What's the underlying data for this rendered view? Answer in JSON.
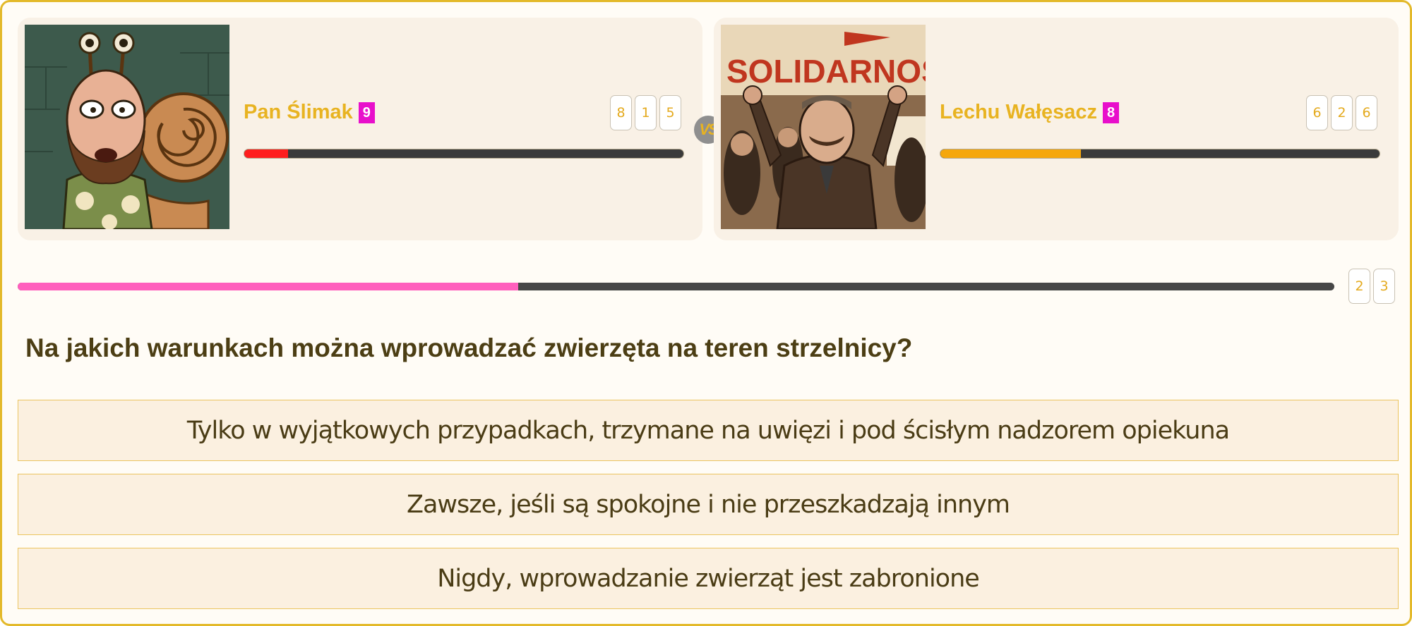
{
  "player1": {
    "name": "Pan Ślimak",
    "level": "9",
    "score_digits": [
      "8",
      "1",
      "5"
    ],
    "hp_fraction": 0.1,
    "hp_color": "#ff1e1e",
    "avatar_icon": "snail-man-portrait"
  },
  "player2": {
    "name": "Lechu Wałęsacz",
    "level": "8",
    "score_digits": [
      "6",
      "2",
      "6"
    ],
    "hp_fraction": 0.32,
    "hp_color": "#f5a70d",
    "avatar_icon": "solidarnosc-rally-portrait",
    "avatar_text": "SOLIDARNOŚĆ"
  },
  "vs_label": "VS",
  "quiz": {
    "progress_fraction": 0.38,
    "progress_color": "#ff5fbd",
    "counter_digits": [
      "2",
      "3"
    ],
    "question": "Na jakich warunkach można wprowadzać zwierzęta na teren strzelnicy?",
    "answers": [
      "Tylko w wyjątkowych przypadkach, trzymane na uwięzi i pod ścisłym nadzorem opiekuna",
      "Zawsze, jeśli są spokojne i nie przeszkadzają innym",
      "Nigdy, wprowadzanie zwierząt jest zabronione"
    ]
  },
  "colors": {
    "accent": "#e8b321",
    "level_badge": "#e80fcb",
    "answer_bg": "#fbf0e0",
    "answer_border": "#ebc45f",
    "frame_border": "#e3b92a"
  }
}
